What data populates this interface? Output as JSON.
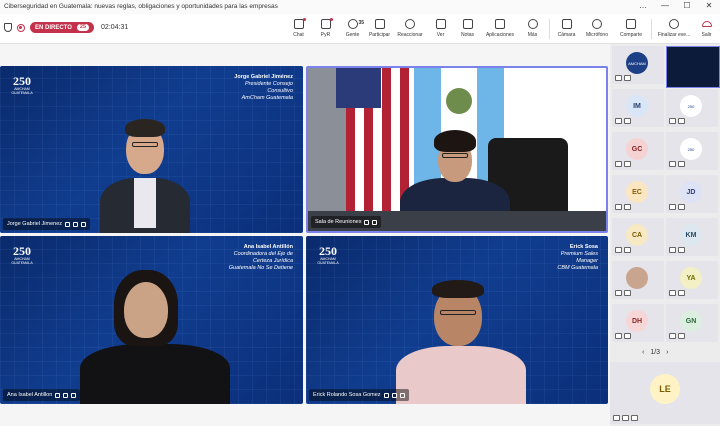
{
  "window": {
    "title": "Ciberseguridad en Guatemala: nuevas reglas, obligaciones y oportunidades para las empresas",
    "controls": [
      "…",
      "—",
      "☐",
      "✕"
    ]
  },
  "status": {
    "live_label": "EN DIRECTO",
    "viewer_count": "25",
    "timer": "02:04:31"
  },
  "toolbar": [
    {
      "id": "chat",
      "label": "Chat",
      "icon": "chat-icon"
    },
    {
      "id": "pyr",
      "label": "PyR",
      "icon": "qa-icon"
    },
    {
      "id": "people",
      "label": "Gente",
      "icon": "people-icon",
      "count": "35"
    },
    {
      "id": "raise",
      "label": "Participar",
      "icon": "hand-icon"
    },
    {
      "id": "react",
      "label": "Reaccionar",
      "icon": "smile-icon"
    },
    {
      "id": "view",
      "label": "Ver",
      "icon": "grid-icon"
    },
    {
      "id": "notes",
      "label": "Notas",
      "icon": "notes-icon"
    },
    {
      "id": "apps",
      "label": "Aplicaciones",
      "icon": "plus-icon"
    },
    {
      "id": "more",
      "label": "Más",
      "icon": "more-icon"
    },
    {
      "id": "camera",
      "label": "Cámara",
      "icon": "camera-off-icon"
    },
    {
      "id": "mic",
      "label": "Micrófono",
      "icon": "mic-off-icon"
    },
    {
      "id": "share",
      "label": "Comparte",
      "icon": "share-icon"
    },
    {
      "id": "end",
      "label": "Finalizar eve...",
      "icon": "end-event-icon"
    },
    {
      "id": "leave",
      "label": "Salir",
      "icon": "hangup-icon"
    }
  ],
  "tiles": [
    {
      "name_tag": "Jorge Gabriel Jimenez",
      "caption": [
        "Jorge Gabriel Jiménez",
        "Presidente Consejo",
        "Consultivo",
        "AmCham Guatemala"
      ]
    },
    {
      "name_tag": "Sala de Reuniones",
      "caption": []
    },
    {
      "name_tag": "Ana Isabel Antillon",
      "caption": [
        "Ana Isabel Antillón",
        "Coordinadora del Eje de",
        "Certeza Jurídica",
        "Guatemala No Se Detiene"
      ]
    },
    {
      "name_tag": "Erick Rolando Sosa Gomez",
      "caption": [
        "Erick Sosa",
        "Premium Sales",
        "Manager",
        "CBM Guatemala"
      ]
    }
  ],
  "logo": {
    "big": "250",
    "small": "AMCHAM GUATEMALA"
  },
  "gallery": {
    "initials": [
      "IM",
      "GC",
      "EC",
      "JD",
      "CA",
      "KM",
      "YA",
      "DH",
      "GN"
    ],
    "page": "1/3",
    "bottom_initials": "LE",
    "amcham_pic": "AMCHAM"
  },
  "colors": {
    "accent": "#7b83eb",
    "live": "#c4314b"
  }
}
